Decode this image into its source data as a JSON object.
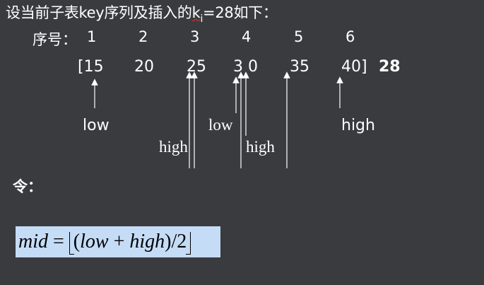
{
  "title": {
    "before": "设当前子表key序列及插入的",
    "k": "k",
    "sub": "i",
    "after": "=28如下："
  },
  "index_label": "序号：",
  "indices": [
    "1",
    "2",
    "3",
    "4",
    "5",
    "6"
  ],
  "array": {
    "open": "[15",
    "v2": "20",
    "v3": "25",
    "v4": "3 0",
    "v5": "35",
    "v6": "40]",
    "key": "28"
  },
  "labels": {
    "low1": "low",
    "high1": "high",
    "low2": "low",
    "high2": "high",
    "high3": "high"
  },
  "ling": "令：",
  "formula": {
    "lhs": "mid",
    "eq": " = ",
    "open": "(",
    "low": "low",
    "plus": " + ",
    "high": "high",
    "close": ")/2"
  }
}
